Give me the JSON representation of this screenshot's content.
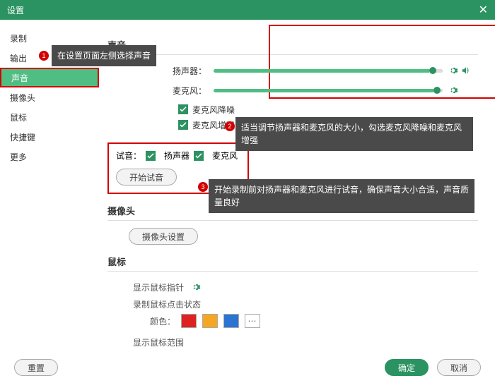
{
  "titlebar": {
    "title": "设置"
  },
  "sidebar": {
    "items": [
      {
        "label": "录制"
      },
      {
        "label": "输出"
      },
      {
        "label": "声音"
      },
      {
        "label": "摄像头"
      },
      {
        "label": "鼠标"
      },
      {
        "label": "快捷键"
      },
      {
        "label": "更多"
      }
    ]
  },
  "sound": {
    "title": "声音",
    "speaker_label": "扬声器：",
    "mic_label": "麦克风：",
    "noise_reduce": "麦克风降噪",
    "enhance": "麦克风增强",
    "test_label": "试音：",
    "test_speaker": "扬声器",
    "test_mic": "麦克风",
    "start_test": "开始试音"
  },
  "camera": {
    "title": "摄像头",
    "settings_btn": "摄像头设置"
  },
  "mouse": {
    "title": "鼠标",
    "show_pointer": "显示鼠标指针",
    "record_click": "录制鼠标点击状态",
    "color_label": "颜色：",
    "show_range": "显示鼠标范围",
    "colors": {
      "red": "#d22",
      "orange": "#f5a623",
      "blue": "#2b74d2"
    }
  },
  "footer": {
    "reset": "重置",
    "ok": "确定",
    "cancel": "取消"
  },
  "annotations": {
    "tip1": "在设置页面左侧选择声音",
    "tip2": "适当调节扬声器和麦克风的大小，勾选麦克风降噪和麦克风增强",
    "tip3": "开始录制前对扬声器和麦克风进行试音，确保声音大小合适，声音质量良好",
    "n1": "1",
    "n2": "2",
    "n3": "3"
  }
}
